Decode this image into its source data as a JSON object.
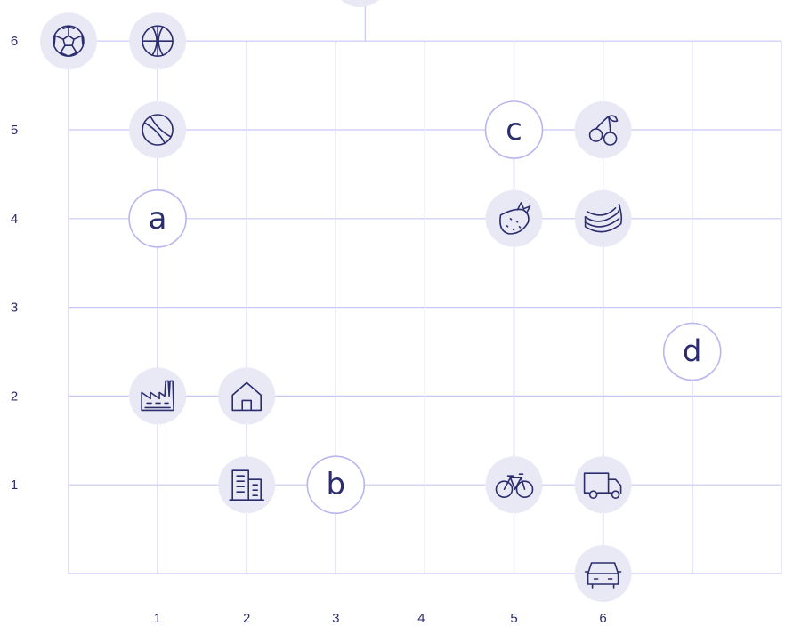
{
  "x_ticks": [
    "1",
    "2",
    "3",
    "4",
    "5",
    "6"
  ],
  "y_ticks": [
    "1",
    "2",
    "3",
    "4",
    "5",
    "6"
  ],
  "colors": {
    "grid": "#c9c8f3",
    "disc_fill": "#e9e9f6",
    "ink": "#2b2d6e",
    "letter_ring": "#b8b6ee"
  },
  "tokens": [
    {
      "kind": "icon",
      "icon": "soccer-ball-icon",
      "x": 0,
      "y": 6
    },
    {
      "kind": "icon",
      "icon": "basketball-icon",
      "x": 1,
      "y": 6
    },
    {
      "kind": "icon",
      "icon": "tennis-ball-icon",
      "x": 1,
      "y": 5
    },
    {
      "kind": "letter",
      "label": "a",
      "x": 1,
      "y": 4
    },
    {
      "kind": "icon",
      "icon": "factory-icon",
      "x": 1,
      "y": 2
    },
    {
      "kind": "icon",
      "icon": "house-icon",
      "x": 2,
      "y": 2
    },
    {
      "kind": "icon",
      "icon": "office-building-icon",
      "x": 2,
      "y": 1
    },
    {
      "kind": "letter",
      "label": "b",
      "x": 3,
      "y": 1
    },
    {
      "kind": "letter",
      "label": "c",
      "x": 5,
      "y": 5
    },
    {
      "kind": "icon",
      "icon": "cherries-icon",
      "x": 6,
      "y": 5
    },
    {
      "kind": "icon",
      "icon": "strawberry-icon",
      "x": 5,
      "y": 4
    },
    {
      "kind": "icon",
      "icon": "bananas-icon",
      "x": 6,
      "y": 4
    },
    {
      "kind": "letter",
      "label": "d",
      "x": 7,
      "y": 2.5
    },
    {
      "kind": "icon",
      "icon": "bicycle-icon",
      "x": 5,
      "y": 1
    },
    {
      "kind": "icon",
      "icon": "truck-icon",
      "x": 6,
      "y": 1
    },
    {
      "kind": "icon",
      "icon": "car-icon",
      "x": 6,
      "y": 0
    }
  ]
}
